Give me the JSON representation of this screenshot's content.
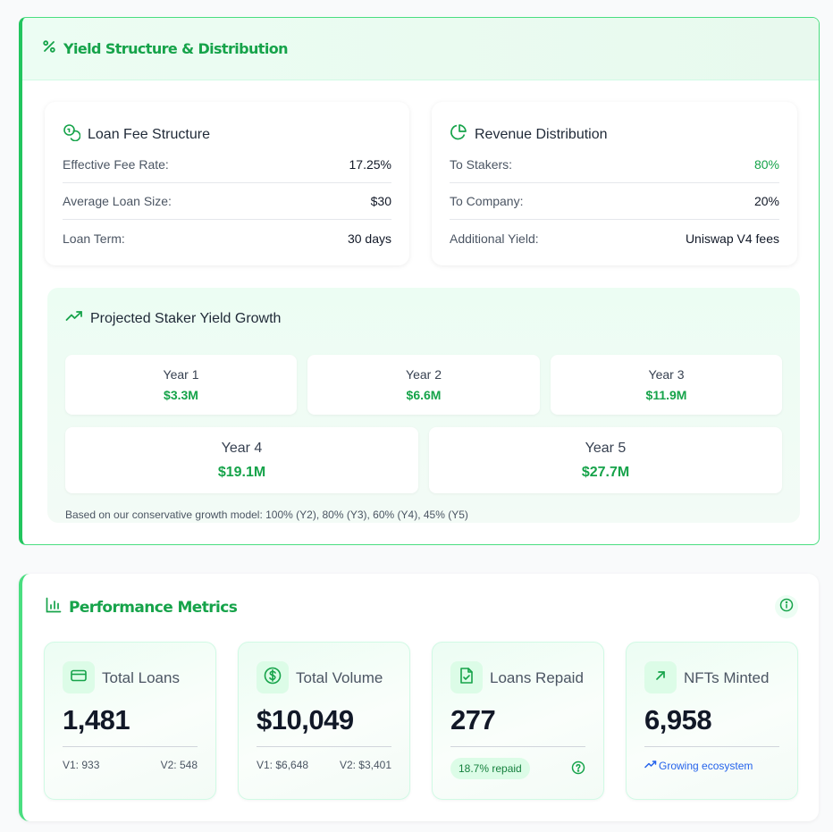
{
  "yield": {
    "title": "Yield Structure & Distribution",
    "loan_fee": {
      "title": "Loan Fee Structure",
      "rows": [
        {
          "label": "Effective Fee Rate:",
          "value": "17.25%"
        },
        {
          "label": "Average Loan Size:",
          "value": "$30"
        },
        {
          "label": "Loan Term:",
          "value": "30 days"
        }
      ]
    },
    "revenue": {
      "title": "Revenue Distribution",
      "rows": [
        {
          "label": "To Stakers:",
          "value": "80%"
        },
        {
          "label": "To Company:",
          "value": "20%"
        },
        {
          "label": "Additional Yield:",
          "value": "Uniswap V4 fees"
        }
      ]
    },
    "projection": {
      "title": "Projected Staker Yield Growth",
      "years": [
        {
          "label": "Year 1",
          "value": "$3.3M"
        },
        {
          "label": "Year 2",
          "value": "$6.6M"
        },
        {
          "label": "Year 3",
          "value": "$11.9M"
        },
        {
          "label": "Year 4",
          "value": "$19.1M"
        },
        {
          "label": "Year 5",
          "value": "$27.7M"
        }
      ],
      "note": "Based on our conservative growth model: 100% (Y2), 80% (Y3), 60% (Y4), 45% (Y5)"
    }
  },
  "performance": {
    "title": "Performance Metrics",
    "metrics": [
      {
        "title": "Total Loans",
        "value": "1,481",
        "foot_left": "V1: 933",
        "foot_right": "V2: 548",
        "icon": "credit-card-icon"
      },
      {
        "title": "Total Volume",
        "value": "$10,049",
        "foot_left": "V1: $6,648",
        "foot_right": "V2: $3,401",
        "icon": "dollar-circle-icon"
      },
      {
        "title": "Loans Repaid",
        "value": "277",
        "badge": "18.7% repaid",
        "icon": "file-check-icon"
      },
      {
        "title": "NFTs Minted",
        "value": "6,958",
        "foot_link": "Growing ecosystem",
        "icon": "arrow-up-right-icon"
      }
    ]
  },
  "colors": {
    "accent": "#16a34a",
    "accent_light": "#dcfce7",
    "link": "#2563eb"
  }
}
